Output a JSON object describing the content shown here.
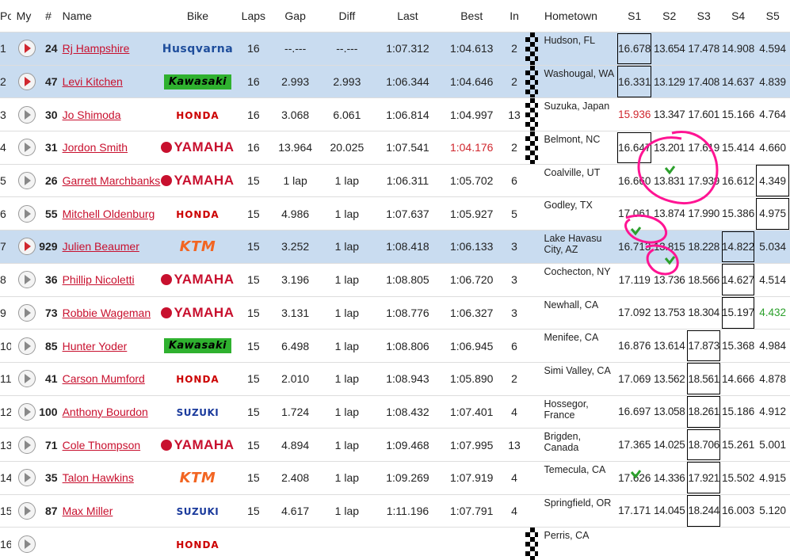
{
  "columns": [
    "Pos",
    "My",
    "#",
    "Name",
    "Bike",
    "Laps",
    "Gap",
    "Diff",
    "Last",
    "Best",
    "In",
    "Hometown",
    "S1",
    "S2",
    "S3",
    "S4",
    "S5"
  ],
  "rows": [
    {
      "pos": "1",
      "my": "red",
      "num": "24",
      "name": "Rj Hampshire",
      "bike": "Husqvarna",
      "laps": "16",
      "gap": "--.---",
      "diff": "--.---",
      "last": "1:07.312",
      "best": "1:04.613",
      "in": "2",
      "flag": true,
      "hometown": "Hudson, FL",
      "s1": "16.678",
      "s2": "13.654",
      "s3": "17.478",
      "s4": "14.908",
      "s5": "4.594",
      "hl": true
    },
    {
      "pos": "2",
      "my": "red",
      "num": "47",
      "name": "Levi Kitchen",
      "bike": "Kawasaki",
      "laps": "16",
      "gap": "2.993",
      "diff": "2.993",
      "last": "1:06.344",
      "best": "1:04.646",
      "in": "2",
      "flag": true,
      "hometown": "Washougal, WA",
      "s1": "16.331",
      "s2": "13.129",
      "s3": "17.408",
      "s4": "14.637",
      "s5": "4.839",
      "hl": true
    },
    {
      "pos": "3",
      "my": "grey",
      "num": "30",
      "name": "Jo Shimoda",
      "bike": "Honda",
      "laps": "16",
      "gap": "3.068",
      "diff": "6.061",
      "last": "1:06.814",
      "best": "1:04.997",
      "in": "13",
      "flag": true,
      "hometown": "Suzuka, Japan",
      "s1": "15.936",
      "s2": "13.347",
      "s3": "17.601",
      "s4": "15.166",
      "s5": "4.764",
      "hl": false
    },
    {
      "pos": "4",
      "my": "grey",
      "num": "31",
      "name": "Jordon Smith",
      "bike": "Yamaha",
      "laps": "16",
      "gap": "13.964",
      "diff": "20.025",
      "last": "1:07.541",
      "best": "1:04.176",
      "in": "2",
      "flag": true,
      "hometown": "Belmont, NC",
      "s1": "16.647",
      "s2": "13.201",
      "s3": "17.619",
      "s4": "15.414",
      "s5": "4.660",
      "hl": false
    },
    {
      "pos": "5",
      "my": "grey",
      "num": "26",
      "name": "Garrett Marchbanks",
      "bike": "Yamaha",
      "laps": "15",
      "gap": "1 lap",
      "diff": "1 lap",
      "last": "1:06.311",
      "best": "1:05.702",
      "in": "6",
      "flag": false,
      "hometown": "Coalville, UT",
      "s1": "16.660",
      "s2": "13.831",
      "s3": "17.939",
      "s4": "16.612",
      "s5": "4.349",
      "hl": false
    },
    {
      "pos": "6",
      "my": "grey",
      "num": "55",
      "name": "Mitchell Oldenburg",
      "bike": "Honda",
      "laps": "15",
      "gap": "4.986",
      "diff": "1 lap",
      "last": "1:07.637",
      "best": "1:05.927",
      "in": "5",
      "flag": false,
      "hometown": "Godley, TX",
      "s1": "17.061",
      "s2": "13.874",
      "s3": "17.990",
      "s4": "15.386",
      "s5": "4.975",
      "hl": false
    },
    {
      "pos": "7",
      "my": "red",
      "num": "929",
      "name": "Julien Beaumer",
      "bike": "KTM",
      "laps": "15",
      "gap": "3.252",
      "diff": "1 lap",
      "last": "1:08.418",
      "best": "1:06.133",
      "in": "3",
      "flag": false,
      "hometown": "Lake Havasu City, AZ",
      "s1": "16.713",
      "s2": "13.815",
      "s3": "18.228",
      "s4": "14.822",
      "s5": "5.034",
      "hl": true
    },
    {
      "pos": "8",
      "my": "grey",
      "num": "36",
      "name": "Phillip Nicoletti",
      "bike": "Yamaha",
      "laps": "15",
      "gap": "3.196",
      "diff": "1 lap",
      "last": "1:08.805",
      "best": "1:06.720",
      "in": "3",
      "flag": false,
      "hometown": "Cochecton, NY",
      "s1": "17.119",
      "s2": "13.736",
      "s3": "18.566",
      "s4": "14.627",
      "s5": "4.514",
      "hl": false
    },
    {
      "pos": "9",
      "my": "grey",
      "num": "73",
      "name": "Robbie Wageman",
      "bike": "Yamaha",
      "laps": "15",
      "gap": "3.131",
      "diff": "1 lap",
      "last": "1:08.776",
      "best": "1:06.327",
      "in": "3",
      "flag": false,
      "hometown": "Newhall, CA",
      "s1": "17.092",
      "s2": "13.753",
      "s3": "18.304",
      "s4": "15.197",
      "s5": "4.432",
      "hl": false
    },
    {
      "pos": "10",
      "my": "grey",
      "num": "85",
      "name": "Hunter Yoder",
      "bike": "Kawasaki",
      "laps": "15",
      "gap": "6.498",
      "diff": "1 lap",
      "last": "1:08.806",
      "best": "1:06.945",
      "in": "6",
      "flag": false,
      "hometown": "Menifee, CA",
      "s1": "16.876",
      "s2": "13.614",
      "s3": "17.873",
      "s4": "15.368",
      "s5": "4.984",
      "hl": false
    },
    {
      "pos": "11",
      "my": "grey",
      "num": "41",
      "name": "Carson Mumford",
      "bike": "Honda",
      "laps": "15",
      "gap": "2.010",
      "diff": "1 lap",
      "last": "1:08.943",
      "best": "1:05.890",
      "in": "2",
      "flag": false,
      "hometown": "Simi Valley, CA",
      "s1": "17.069",
      "s2": "13.562",
      "s3": "18.561",
      "s4": "14.666",
      "s5": "4.878",
      "hl": false
    },
    {
      "pos": "12",
      "my": "grey",
      "num": "100",
      "name": "Anthony Bourdon",
      "bike": "Suzuki",
      "laps": "15",
      "gap": "1.724",
      "diff": "1 lap",
      "last": "1:08.432",
      "best": "1:07.401",
      "in": "4",
      "flag": false,
      "hometown": "Hossegor, France",
      "s1": "16.697",
      "s2": "13.058",
      "s3": "18.261",
      "s4": "15.186",
      "s5": "4.912",
      "hl": false
    },
    {
      "pos": "13",
      "my": "grey",
      "num": "71",
      "name": "Cole Thompson",
      "bike": "Yamaha",
      "laps": "15",
      "gap": "4.894",
      "diff": "1 lap",
      "last": "1:09.468",
      "best": "1:07.995",
      "in": "13",
      "flag": false,
      "hometown": "Brigden, Canada",
      "s1": "17.365",
      "s2": "14.025",
      "s3": "18.706",
      "s4": "15.261",
      "s5": "5.001",
      "hl": false
    },
    {
      "pos": "14",
      "my": "grey",
      "num": "35",
      "name": "Talon Hawkins",
      "bike": "KTM",
      "laps": "15",
      "gap": "2.408",
      "diff": "1 lap",
      "last": "1:09.269",
      "best": "1:07.919",
      "in": "4",
      "flag": false,
      "hometown": "Temecula, CA",
      "s1": "17.626",
      "s2": "14.336",
      "s3": "17.921",
      "s4": "15.502",
      "s5": "4.915",
      "hl": false
    },
    {
      "pos": "15",
      "my": "grey",
      "num": "87",
      "name": "Max Miller",
      "bike": "Suzuki",
      "laps": "15",
      "gap": "4.617",
      "diff": "1 lap",
      "last": "1:11.196",
      "best": "1:07.791",
      "in": "4",
      "flag": false,
      "hometown": "Springfield, OR",
      "s1": "17.171",
      "s2": "14.045",
      "s3": "18.244",
      "s4": "16.003",
      "s5": "5.120",
      "hl": false
    },
    {
      "pos": "16",
      "my": "grey",
      "num": "",
      "name": "",
      "bike": "Honda",
      "laps": "",
      "gap": "",
      "diff": "",
      "last": "",
      "best": "",
      "in": "",
      "flag": true,
      "hometown": "Perris, CA",
      "s1": "",
      "s2": "",
      "s3": "",
      "s4": "",
      "s5": "",
      "hl": false
    }
  ],
  "bike_labels": {
    "Husqvarna": "Husqvarna",
    "Kawasaki": "Kawasaki",
    "Honda": "HONDA",
    "Yamaha": "YAMAHA",
    "KTM": "KTM",
    "Suzuki": "SUZUKI"
  },
  "colors": {
    "highlight": "#c9dcf0",
    "red": "#d0272e",
    "green": "#2ca02c",
    "annotation": "#ff1493"
  },
  "styles": {
    "best_red": [
      3
    ],
    "s1_red": [
      2
    ],
    "s5_green": [
      8
    ],
    "boxed": {
      "s1": [
        0,
        1,
        3
      ],
      "s3": [
        9,
        10,
        11,
        12,
        13,
        14
      ],
      "s4": [
        6,
        7,
        8
      ],
      "s5": [
        4,
        5
      ]
    }
  }
}
